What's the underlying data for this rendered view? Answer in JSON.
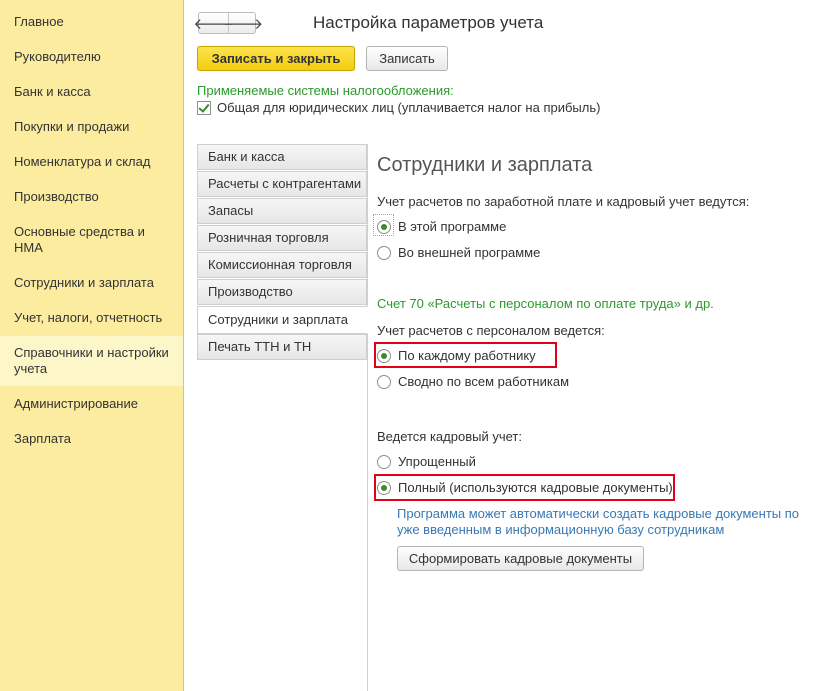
{
  "sidebar": {
    "items": [
      {
        "label": "Главное"
      },
      {
        "label": "Руководителю"
      },
      {
        "label": "Банк и касса"
      },
      {
        "label": "Покупки и продажи"
      },
      {
        "label": "Номенклатура и склад"
      },
      {
        "label": "Производство"
      },
      {
        "label": "Основные средства и НМА"
      },
      {
        "label": "Сотрудники и зарплата"
      },
      {
        "label": "Учет, налоги, отчетность"
      },
      {
        "label": "Справочники и настройки учета"
      },
      {
        "label": "Администрирование"
      },
      {
        "label": "Зарплата"
      }
    ],
    "active": "Справочники и настройки учета"
  },
  "header": {
    "back_glyph": "🡐",
    "forward_glyph": "🡒",
    "title": "Настройка параметров учета"
  },
  "toolbar": {
    "save_close_label": "Записать и закрыть",
    "save_label": "Записать"
  },
  "tax": {
    "label": "Применяемые системы налогообложения:",
    "checkbox_label": "Общая для юридических лиц (уплачивается налог на прибыль)",
    "checked": true
  },
  "tabs": [
    {
      "label": "Банк и касса"
    },
    {
      "label": "Расчеты с контрагентами"
    },
    {
      "label": "Запасы"
    },
    {
      "label": "Розничная торговля"
    },
    {
      "label": "Комиссионная торговля"
    },
    {
      "label": "Производство"
    },
    {
      "label": "Сотрудники и зарплата"
    },
    {
      "label": "Печать ТТН и ТН"
    }
  ],
  "active_tab": "Сотрудники и зарплата",
  "panel": {
    "title": "Сотрудники и зарплата",
    "payroll_question": "Учет расчетов по заработной плате и кадровый учет ведутся:",
    "payroll_options": [
      "В этой программе",
      "Во внешней программе"
    ],
    "account_note": "Счет 70 «Расчеты с персоналом по оплате труда» и др.",
    "personnel_question": "Учет расчетов с персоналом ведется:",
    "personnel_options": [
      "По каждому работнику",
      "Сводно по всем работникам"
    ],
    "hr_question": "Ведется кадровый учет:",
    "hr_options": [
      "Упрощенный",
      "Полный (используются кадровые документы)"
    ],
    "hr_note": "Программа может автоматически создать кадровые документы по уже введенным в информационную базу сотрудникам",
    "generate_button": "Сформировать кадровые документы"
  }
}
